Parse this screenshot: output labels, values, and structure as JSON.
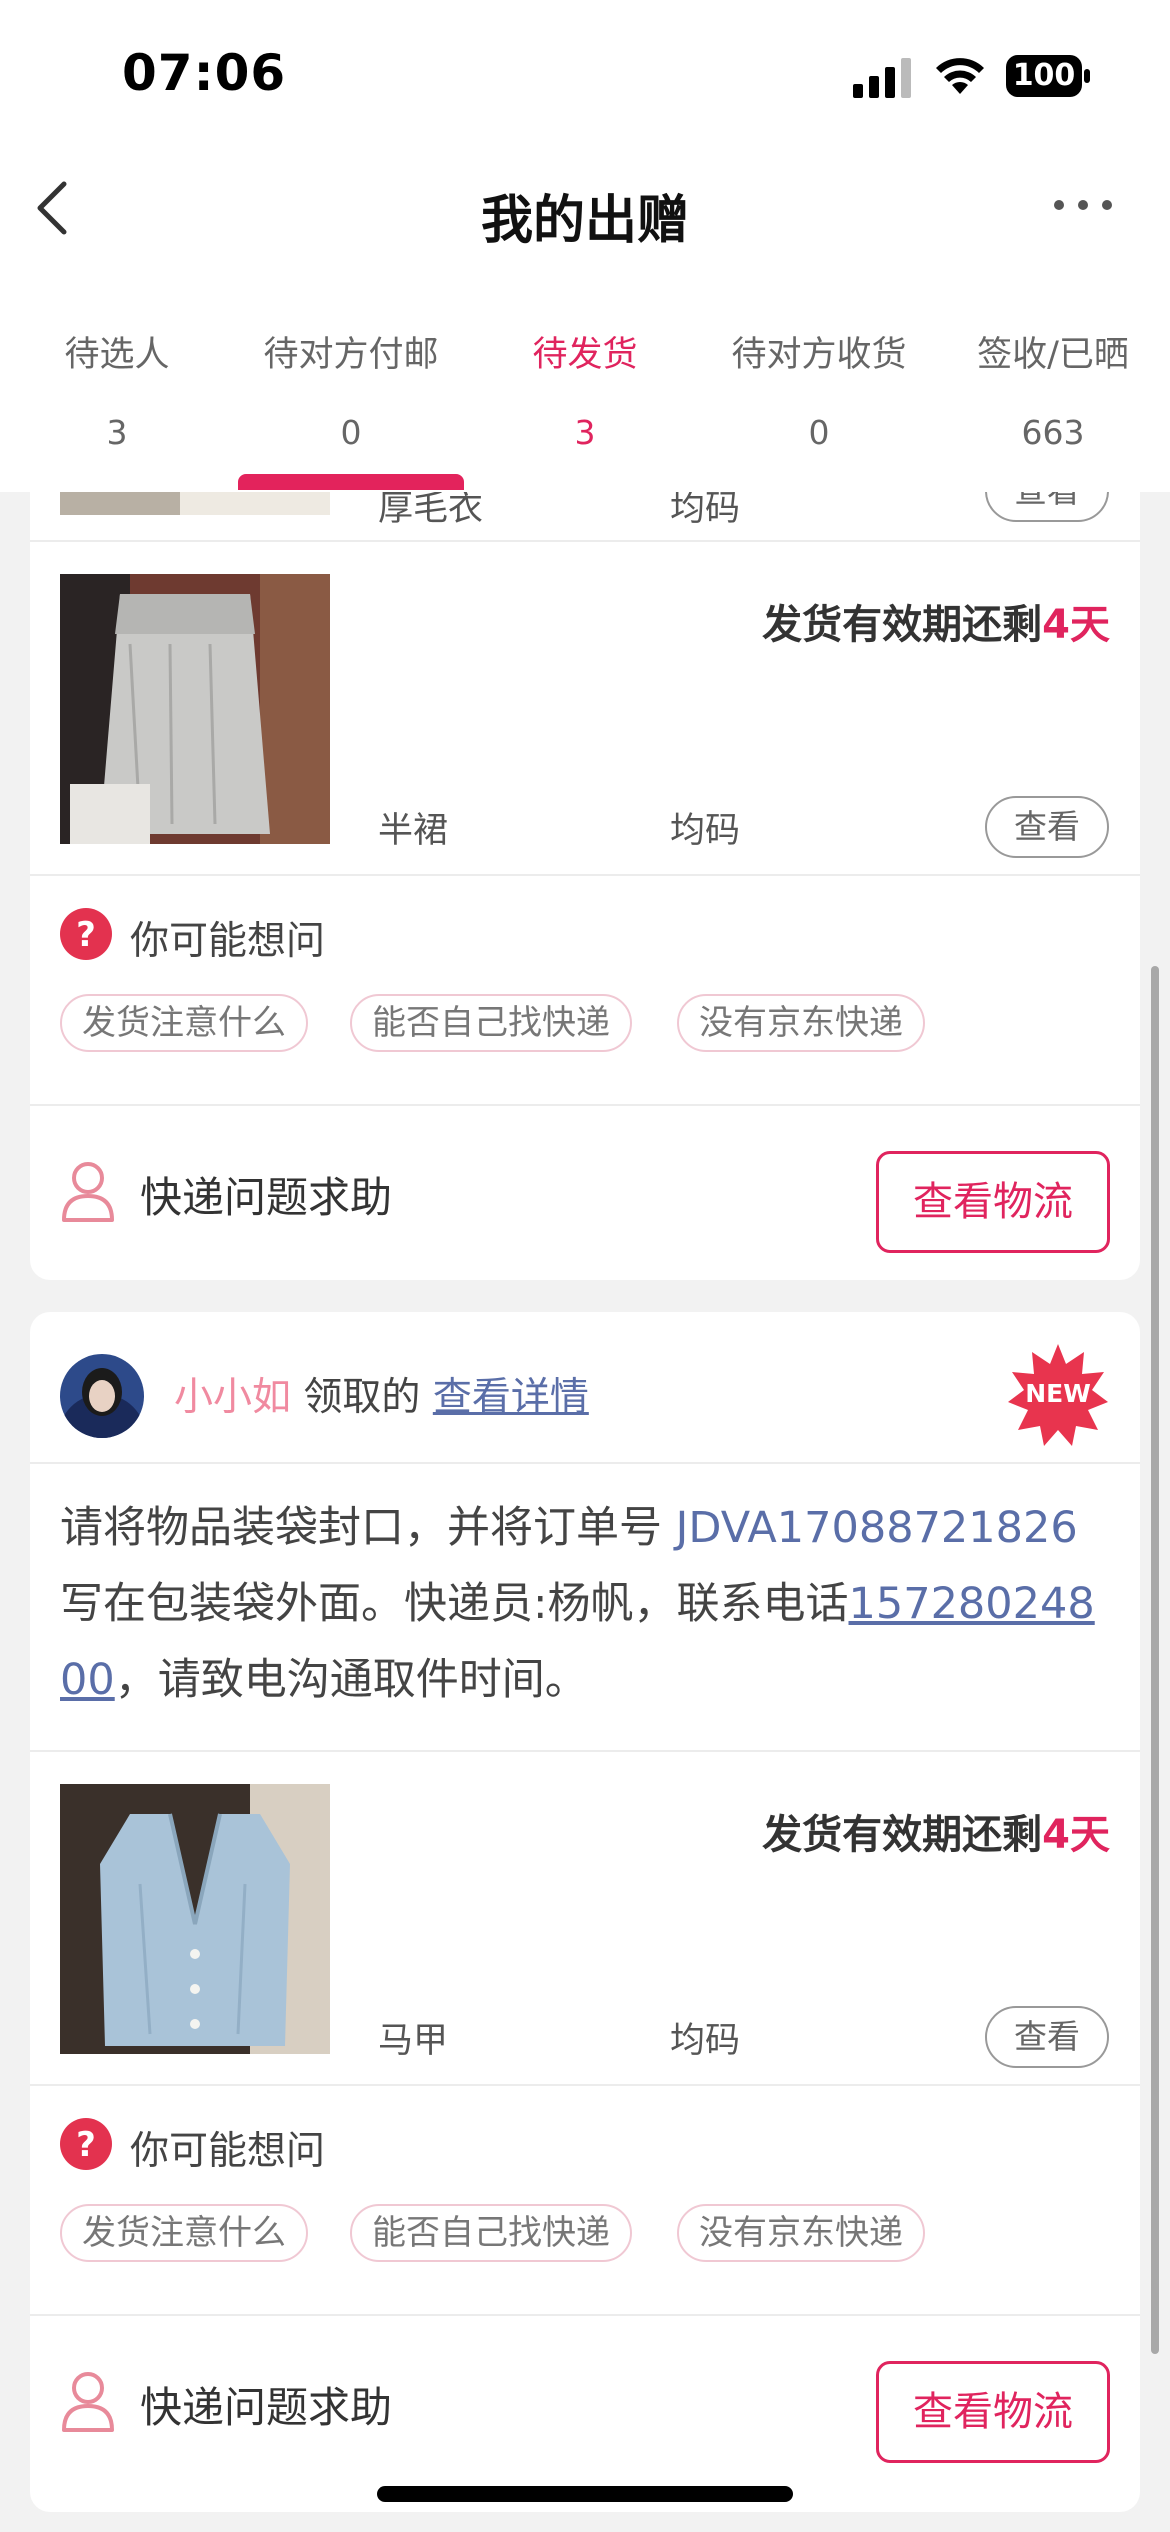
{
  "status_bar": {
    "time": "07:06",
    "battery": "100"
  },
  "nav": {
    "title": "我的出赠"
  },
  "tabs": [
    {
      "label": "待选人",
      "count": "3"
    },
    {
      "label": "待对方付邮",
      "count": "0"
    },
    {
      "label": "待发货",
      "count": "3",
      "active": true
    },
    {
      "label": "待对方收货",
      "count": "0"
    },
    {
      "label": "签收/已晒",
      "count": "663"
    }
  ],
  "card1": {
    "prev_item": {
      "name": "厚毛衣",
      "size": "均码",
      "view": "查看"
    },
    "item": {
      "name": "半裙",
      "size": "均码",
      "view": "查看",
      "deadline_prefix": "发货有效期还剩",
      "deadline_days": "4天"
    },
    "faq": {
      "title": "你可能想问",
      "chips": [
        "发货注意什么",
        "能否自己找快递",
        "没有京东快递"
      ]
    },
    "help": {
      "label": "快递问题求助",
      "button": "查看物流"
    }
  },
  "card2": {
    "claimer": {
      "name": "小小如",
      "suffix": " 领取的 ",
      "detail_link": "查看详情"
    },
    "new_badge": "NEW",
    "instruction": {
      "part1": "请将物品装袋封口，并将订单号 ",
      "order_no": "JDVA17088721826",
      "part2": " 写在包装袋外面。快递员:杨帆，联系电话",
      "phone": "15728024800",
      "part3": "，请致电沟通取件时间。"
    },
    "item": {
      "name": "马甲",
      "size": "均码",
      "view": "查看",
      "deadline_prefix": "发货有效期还剩",
      "deadline_days": "4天"
    },
    "faq": {
      "title": "你可能想问",
      "chips": [
        "发货注意什么",
        "能否自己找快递",
        "没有京东快递"
      ]
    },
    "help": {
      "label": "快递问题求助",
      "button": "查看物流"
    }
  },
  "colors": {
    "accent": "#e0245e",
    "link": "#5a6ea8",
    "claimer": "#f08aa0"
  }
}
